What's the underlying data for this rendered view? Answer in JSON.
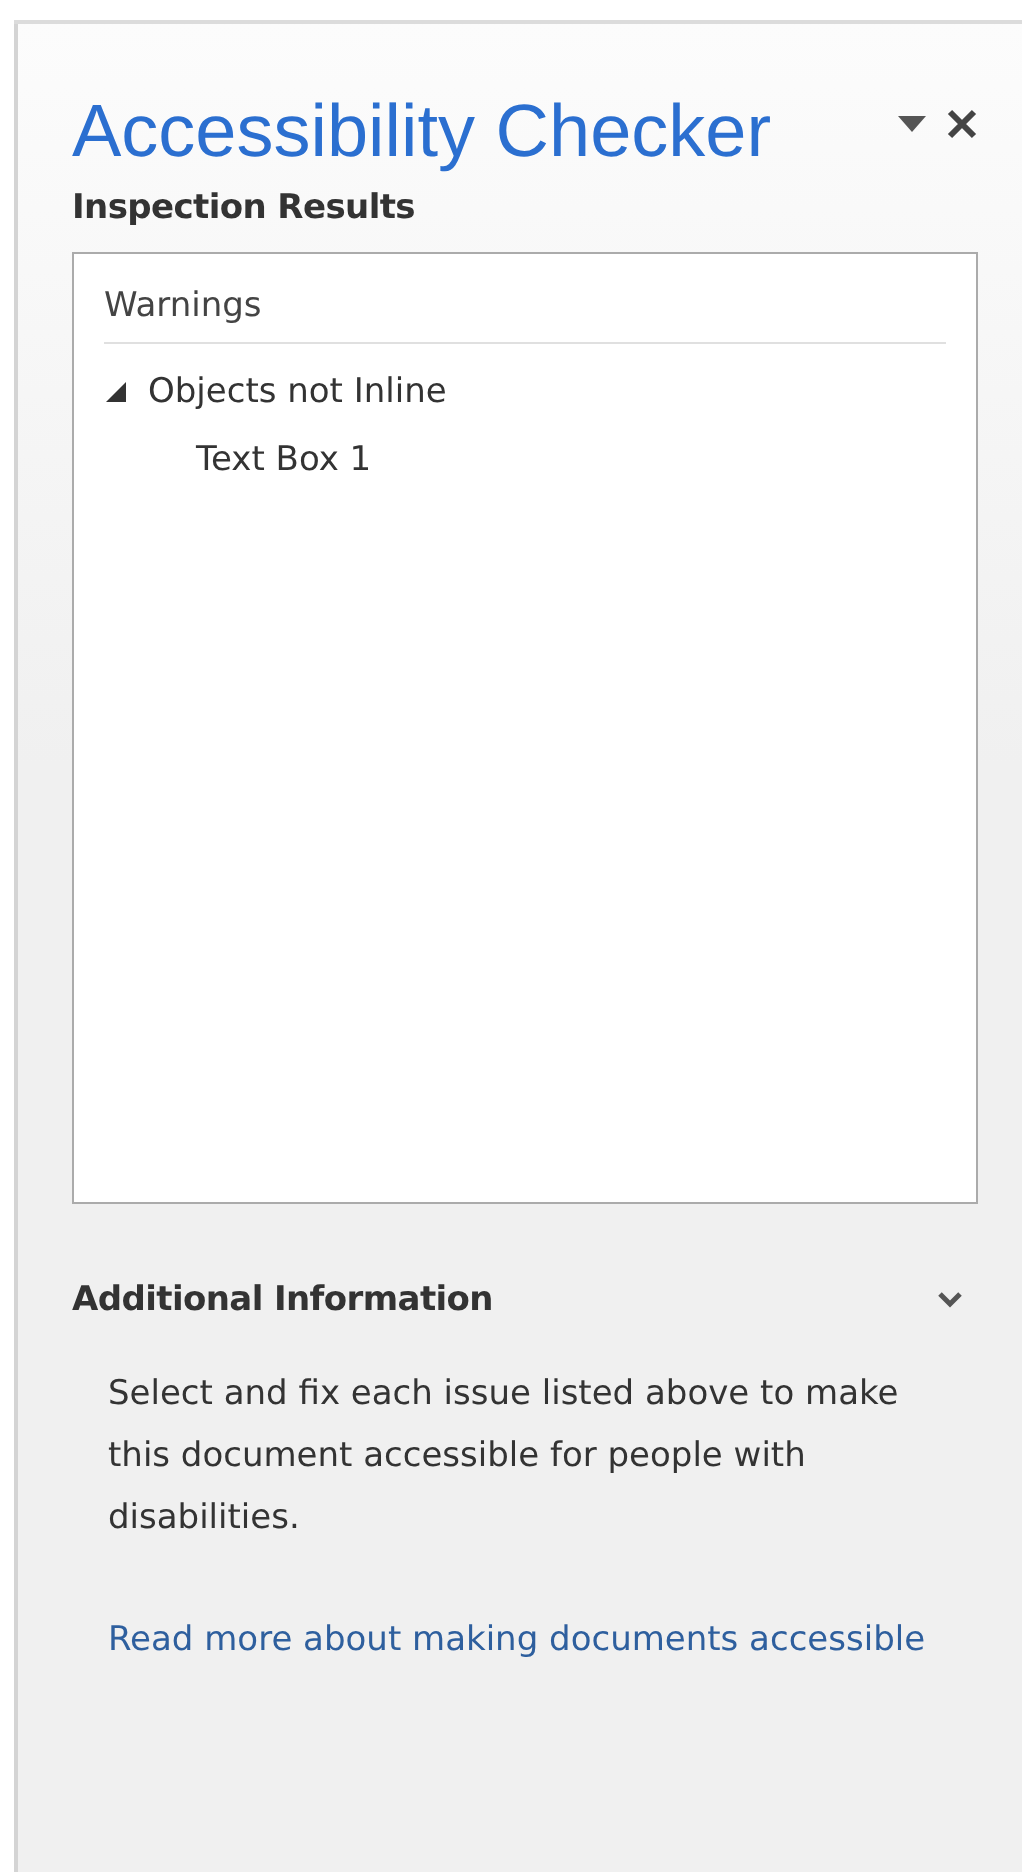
{
  "pane": {
    "title": "Accessibility Checker"
  },
  "inspection": {
    "heading": "Inspection Results",
    "tree": [
      {
        "label": "Warnings",
        "kind": "category",
        "children": [
          {
            "label": "Objects not Inline",
            "kind": "group",
            "expanded": true,
            "children": [
              {
                "label": "Text Box 1",
                "kind": "item"
              }
            ]
          }
        ]
      }
    ]
  },
  "additional_info": {
    "heading": "Additional Information",
    "expanded": true,
    "text": "Select and fix each issue listed above to make this document accessible for people with disabilities.",
    "link": "Read more about making documents accessible"
  }
}
